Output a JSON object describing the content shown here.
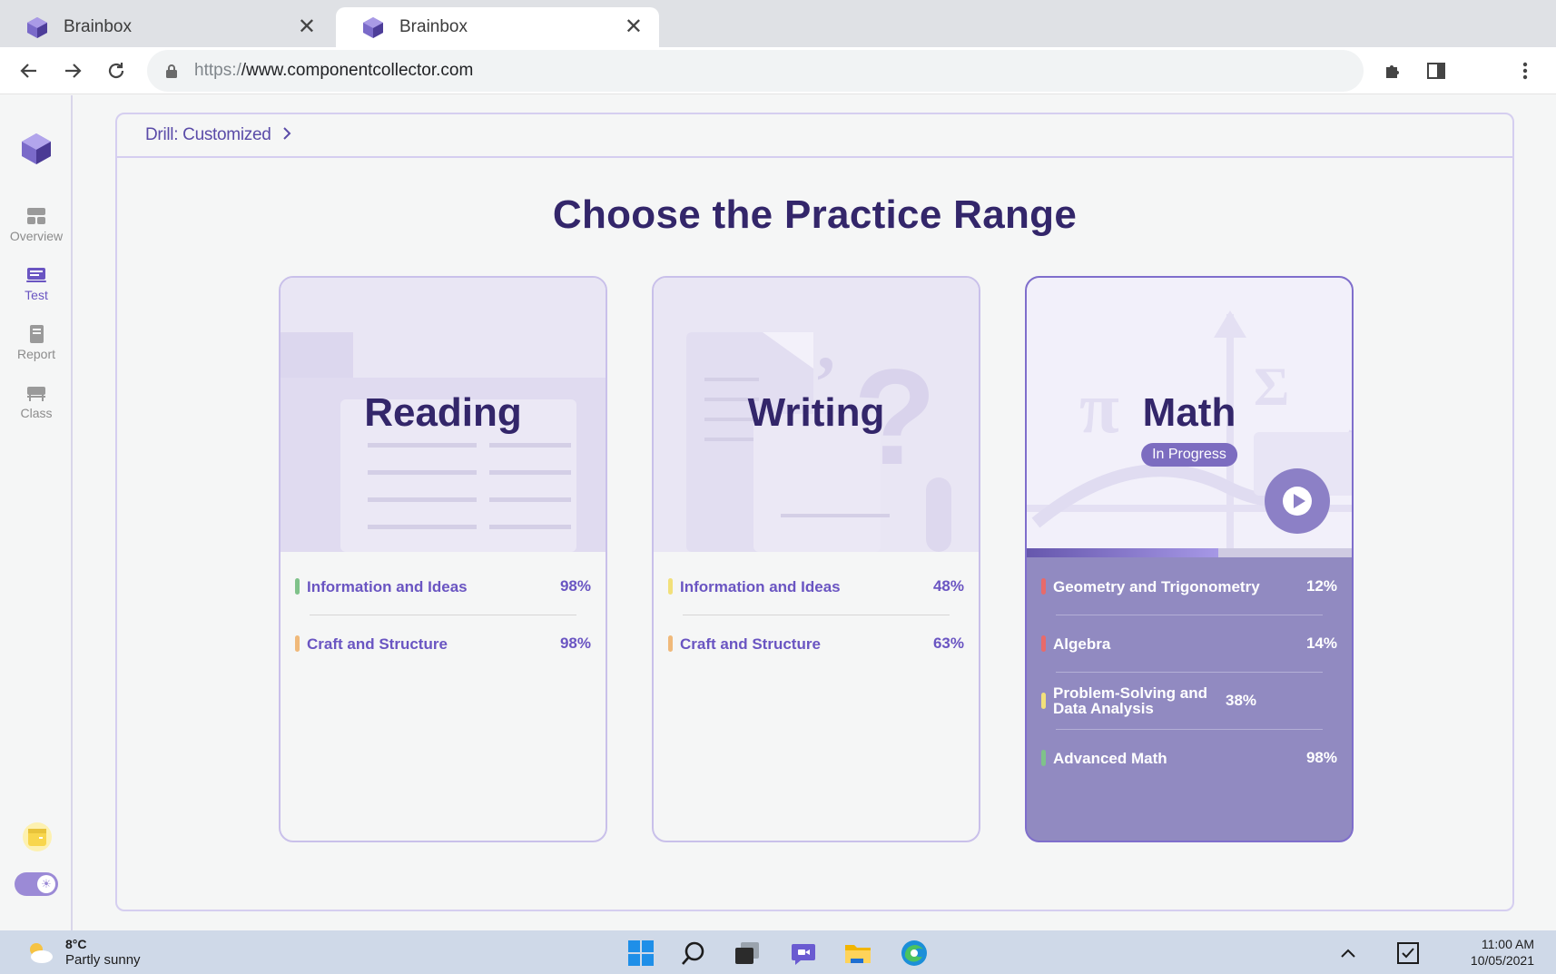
{
  "browser": {
    "tabs": [
      {
        "title": "Brainbox",
        "active": false
      },
      {
        "title": "Brainbox",
        "active": true
      }
    ],
    "url": {
      "protocol": "https:/",
      "host": "/www.componentcollector.com"
    }
  },
  "sidebar": {
    "items": [
      {
        "label": "Overview",
        "icon": "overview-icon",
        "active": false
      },
      {
        "label": "Test",
        "icon": "test-icon",
        "active": true
      },
      {
        "label": "Report",
        "icon": "report-icon",
        "active": false
      },
      {
        "label": "Class",
        "icon": "class-icon",
        "active": false
      }
    ]
  },
  "breadcrumb": {
    "label": "Drill: Customized"
  },
  "heading": "Choose the Practice Range",
  "cards": [
    {
      "title": "Reading",
      "topics": [
        {
          "name": "Information and Ideas",
          "pct": "98%",
          "color": "#7fc28a"
        },
        {
          "name": "Craft and Structure",
          "pct": "98%",
          "color": "#f0b97a"
        }
      ]
    },
    {
      "title": "Writing",
      "topics": [
        {
          "name": "Information and Ideas",
          "pct": "48%",
          "color": "#f2e07a"
        },
        {
          "name": "Craft and Structure",
          "pct": "63%",
          "color": "#f0b97a"
        }
      ]
    },
    {
      "title": "Math",
      "badge": "In Progress",
      "progress": 0.59,
      "topics": [
        {
          "name": "Geometry and Trigonometry",
          "pct": "12%",
          "color": "#e86a6a"
        },
        {
          "name": "Algebra",
          "pct": "14%",
          "color": "#e86a6a"
        },
        {
          "name": "Problem-Solving and Data Analysis",
          "pct": "38%",
          "color": "#f2e07a"
        },
        {
          "name": "Advanced Math",
          "pct": "98%",
          "color": "#7fc28a"
        }
      ]
    }
  ],
  "taskbar": {
    "weather": {
      "temp": "8°C",
      "desc": "Partly sunny"
    },
    "time": "11:00 AM",
    "date": "10/05/2021"
  }
}
